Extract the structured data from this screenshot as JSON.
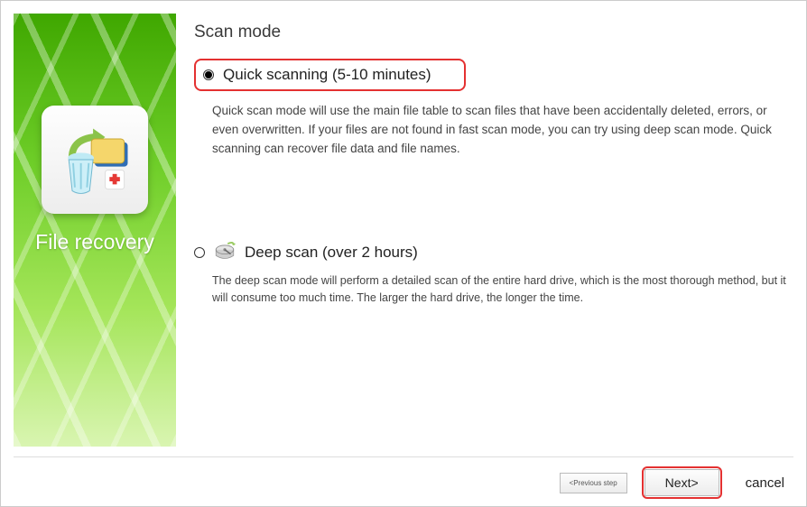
{
  "sidebar": {
    "title": "File recovery"
  },
  "page": {
    "title": "Scan mode"
  },
  "scan": {
    "quick": {
      "label": "Quick scanning (5-10 minutes)",
      "desc": "Quick scan mode will use the main file table to scan files that have been accidentally deleted, errors, or even overwritten. If your files are not found in fast scan mode, you can try using deep scan mode. Quick scanning can recover file data and file names.",
      "selected": true
    },
    "deep": {
      "label": "Deep scan (over 2 hours)",
      "desc": "The deep scan mode will perform a detailed scan of the entire hard drive, which is the most thorough method, but it will consume too much time. The larger the hard drive, the longer the time.",
      "selected": false
    }
  },
  "footer": {
    "prev": "<Previous step",
    "next": "Next>",
    "cancel": "cancel"
  },
  "colors": {
    "highlight_border": "#e43131"
  }
}
